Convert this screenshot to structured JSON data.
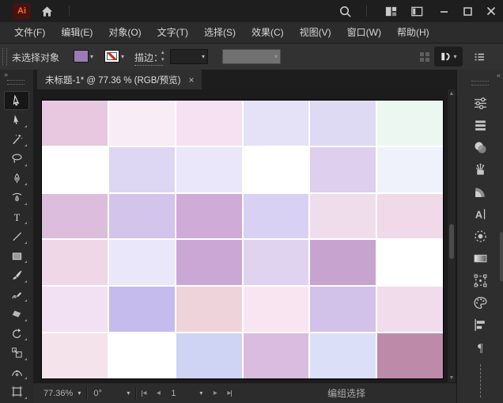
{
  "titlebar": {
    "logo": "Ai",
    "left_icons": [
      "home-icon"
    ],
    "right_icons": [
      "search-icon",
      "arrange-documents-icon",
      "workspace-switcher-icon"
    ],
    "window_controls": [
      "minimize-icon",
      "maximize-icon",
      "close-icon"
    ]
  },
  "menubar": {
    "items": [
      "文件(F)",
      "编辑(E)",
      "对象(O)",
      "文字(T)",
      "选择(S)",
      "效果(C)",
      "视图(V)",
      "窗口(W)",
      "帮助(H)"
    ]
  },
  "controlbar": {
    "selection_status": "未选择对象",
    "fill_color": "#9a7bb5",
    "stroke_none": true,
    "stroke_weight_label": "描边：",
    "right_icons": [
      "grid-icon",
      "arrange-documents-button",
      "panel-list-icon"
    ]
  },
  "tabbar": {
    "document_title": "未标题-1* @ 77.36 % (RGB/预览)",
    "close_glyph": "×",
    "tools_expand_glyph": "»",
    "dock_collapse_glyph": "«"
  },
  "toolbar": {
    "tools": [
      {
        "name": "selection-tool",
        "active": true
      },
      {
        "name": "direct-selection-tool",
        "active": false
      },
      {
        "name": "magic-wand-tool",
        "active": false
      },
      {
        "name": "lasso-tool",
        "active": false
      },
      {
        "name": "pen-tool",
        "active": false
      },
      {
        "name": "curvature-tool",
        "active": false
      },
      {
        "name": "type-tool",
        "active": false
      },
      {
        "name": "line-segment-tool",
        "active": false
      },
      {
        "name": "rectangle-tool",
        "active": false
      },
      {
        "name": "paintbrush-tool",
        "active": false
      },
      {
        "name": "pencil-tool",
        "active": false
      },
      {
        "name": "eraser-tool",
        "active": false
      },
      {
        "name": "rotate-tool",
        "active": false
      },
      {
        "name": "scale-tool",
        "active": false
      },
      {
        "name": "width-tool",
        "active": false
      },
      {
        "name": "artboard-tool",
        "active": false
      }
    ]
  },
  "right_dock": {
    "icons": [
      "properties-icon",
      "layers-icon",
      "transparency-icon",
      "brushes-icon",
      "gradient-fan-icon",
      "character-icon",
      "dashed-circle-icon",
      "gradient-icon",
      "transform-icon",
      "color-palette-icon",
      "align-icon",
      "paragraph-icon"
    ]
  },
  "statusbar": {
    "zoom_level": "77.36%",
    "rotation": "0°",
    "artboard_number": "1",
    "nav_icons": [
      "first-artboard-icon",
      "previous-artboard-icon",
      "next-artboard-icon",
      "last-artboard-icon"
    ],
    "message": "编组选择"
  },
  "canvas": {
    "artboard_bg": "#ffffff",
    "grid_colors": [
      [
        "#e7c8e0",
        "#f8ecf7",
        "#f5e1f2",
        "#e5e1f7",
        "#dedaf4",
        "#edf7f2"
      ],
      [
        "#ffffff",
        "#ded7f3",
        "#e9e7f9",
        "#ffffff",
        "#ddcfed",
        "#eff1fb"
      ],
      [
        "#dcbedc",
        "#d3c4eb",
        "#cfabd8",
        "#d9d1f3",
        "#efddec",
        "#f0d9e9"
      ],
      [
        "#efd7e7",
        "#ebe7fa",
        "#cba7d5",
        "#e0d3ef",
        "#c7a4cf",
        "#ffffff"
      ],
      [
        "#f2e1f2",
        "#c5bbec",
        "#eed3da",
        "#f8e5f1",
        "#d2c1e9",
        "#f1dceb"
      ],
      [
        "#f4e3ea",
        "#ffffff",
        "#cfd3f4",
        "#d9bcdf",
        "#dbdff7",
        "#bd8aaa"
      ]
    ]
  }
}
